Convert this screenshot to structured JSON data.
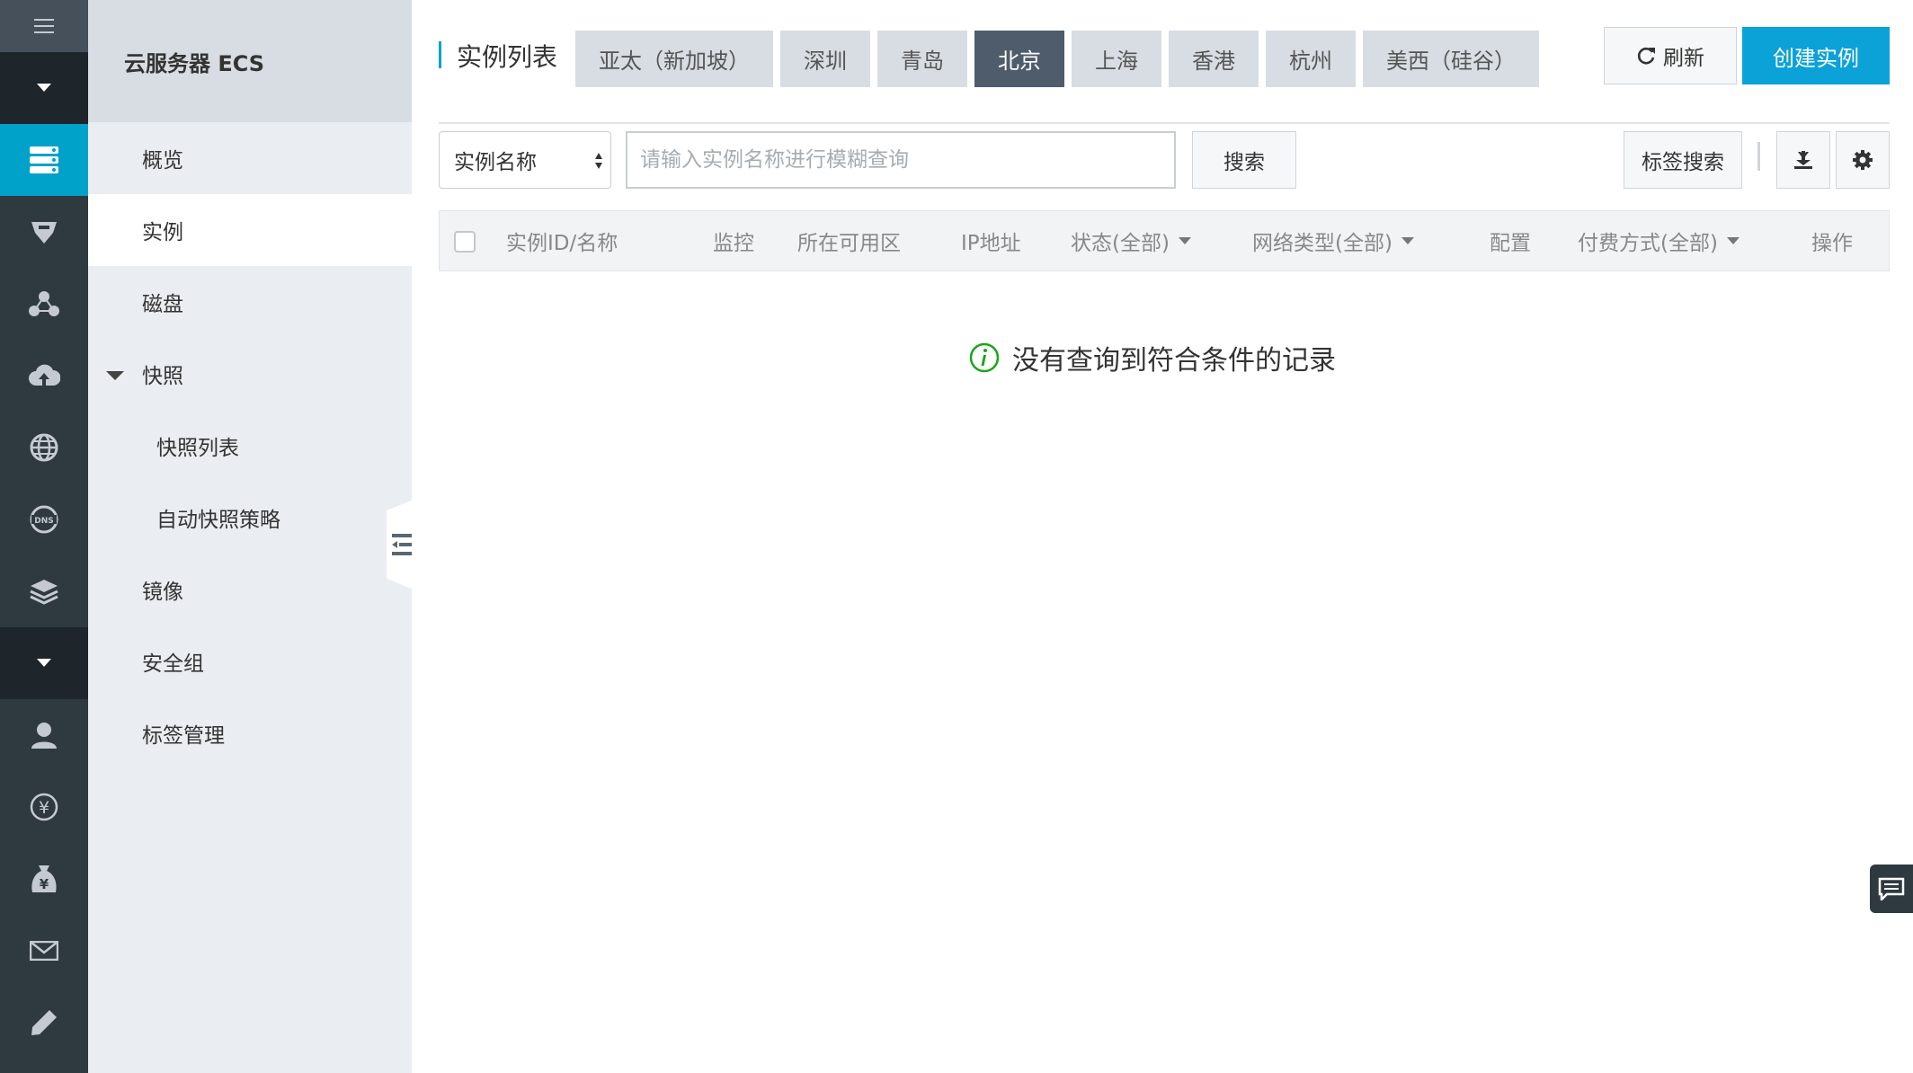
{
  "sidebar": {
    "title": "云服务器 ECS",
    "items": [
      {
        "label": "概览"
      },
      {
        "label": "实例"
      },
      {
        "label": "磁盘"
      },
      {
        "label": "快照"
      },
      {
        "label": "快照列表"
      },
      {
        "label": "自动快照策略"
      },
      {
        "label": "镜像"
      },
      {
        "label": "安全组"
      },
      {
        "label": "标签管理"
      }
    ]
  },
  "rail": {
    "icons": [
      "menu-icon",
      "chevron-down-icon",
      "server-icon",
      "database-icon",
      "network-icon",
      "cloud-upload-icon",
      "globe-icon",
      "dns-icon",
      "layers-icon",
      "chevron-down-icon",
      "user-icon",
      "yen-circle-icon",
      "money-bag-icon",
      "mail-icon",
      "edit-icon"
    ]
  },
  "header": {
    "title": "实例列表",
    "regions": [
      {
        "label": "亚太（新加坡）"
      },
      {
        "label": "深圳"
      },
      {
        "label": "青岛"
      },
      {
        "label": "北京"
      },
      {
        "label": "上海"
      },
      {
        "label": "香港"
      },
      {
        "label": "杭州"
      },
      {
        "label": "美西（硅谷）"
      }
    ],
    "active_region": "北京",
    "refresh_label": "刷新",
    "create_label": "创建实例"
  },
  "toolbar": {
    "select_value": "实例名称",
    "search_placeholder": "请输入实例名称进行模糊查询",
    "search_label": "搜索",
    "tag_search_label": "标签搜索"
  },
  "table": {
    "columns": [
      {
        "label": "实例ID/名称"
      },
      {
        "label": "监控"
      },
      {
        "label": "所在可用区"
      },
      {
        "label": "IP地址"
      },
      {
        "label": "状态(全部)"
      },
      {
        "label": "网络类型(全部)"
      },
      {
        "label": "配置"
      },
      {
        "label": "付费方式(全部)"
      },
      {
        "label": "操作"
      }
    ],
    "empty_message": "没有查询到符合条件的记录"
  },
  "colors": {
    "accent": "#00a2ca",
    "primary_button": "#0ba2d8",
    "active_region": "#4e5c6b",
    "rail_bg": "#2f3940"
  }
}
